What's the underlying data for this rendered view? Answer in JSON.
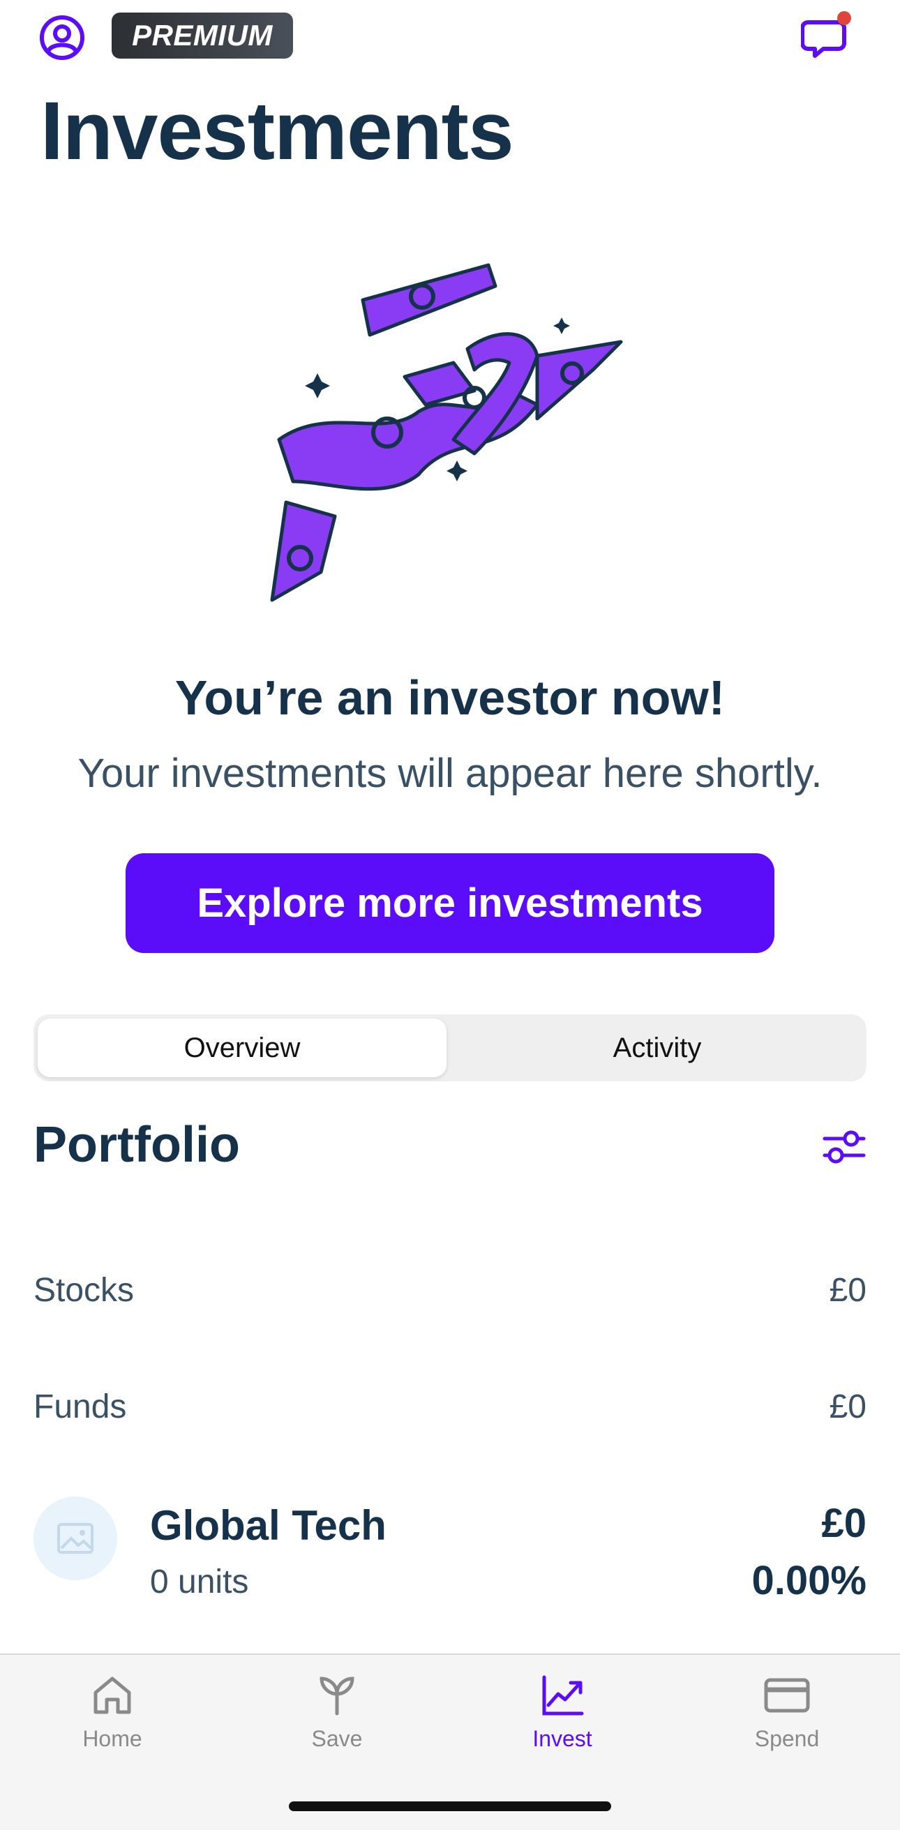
{
  "header": {
    "premium_label": "PREMIUM",
    "title": "Investments"
  },
  "hero": {
    "title": "You’re an investor now!",
    "subtitle": "Your investments will appear here shortly.",
    "cta_label": "Explore more investments"
  },
  "tabs": {
    "overview": "Overview",
    "activity": "Activity",
    "selected": "Overview"
  },
  "portfolio": {
    "title": "Portfolio",
    "rows": [
      {
        "label": "Stocks",
        "value": "£0"
      },
      {
        "label": "Funds",
        "value": "£0"
      }
    ],
    "holding": {
      "name": "Global Tech",
      "units": "0 units",
      "value": "£0",
      "change": "0.00%"
    }
  },
  "nav": {
    "items": [
      {
        "label": "Home",
        "icon": "home-icon"
      },
      {
        "label": "Save",
        "icon": "sprout-icon"
      },
      {
        "label": "Invest",
        "icon": "chart-up-icon"
      },
      {
        "label": "Spend",
        "icon": "card-icon"
      }
    ],
    "active": "Invest"
  },
  "colors": {
    "accent": "#5b0cf8",
    "text_dark": "#16324a",
    "text_muted": "#3a5064",
    "notification_dot": "#e0453a"
  }
}
